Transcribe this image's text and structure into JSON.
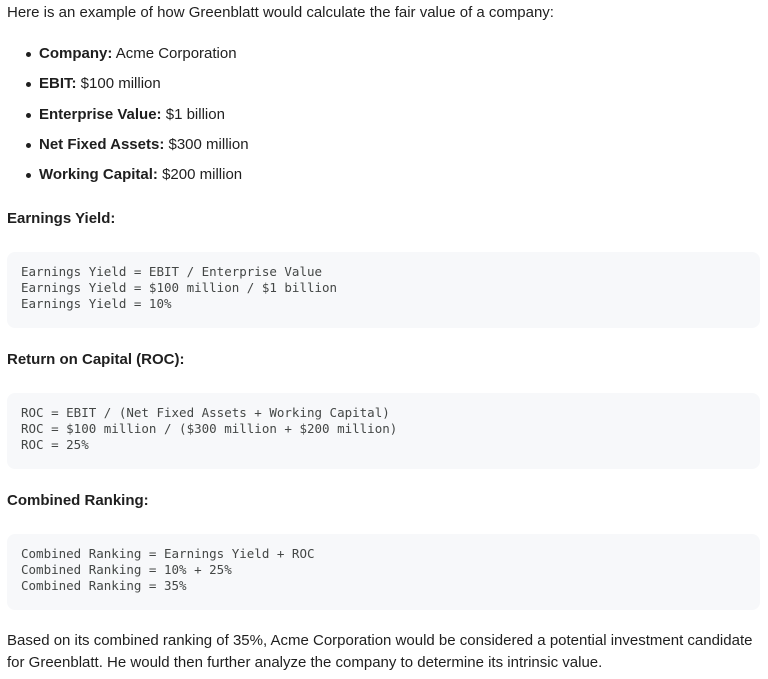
{
  "intro": "Here is an example of how Greenblatt would calculate the fair value of a company:",
  "facts": [
    {
      "key": "Company:",
      "value": "Acme Corporation"
    },
    {
      "key": "EBIT:",
      "value": "$100 million"
    },
    {
      "key": "Enterprise Value:",
      "value": "$1 billion"
    },
    {
      "key": "Net Fixed Assets:",
      "value": "$300 million"
    },
    {
      "key": "Working Capital:",
      "value": "$200 million"
    }
  ],
  "sections": [
    {
      "heading": "Earnings Yield:",
      "code": [
        "Earnings Yield = EBIT / Enterprise Value",
        "Earnings Yield = $100 million / $1 billion",
        "Earnings Yield = 10%"
      ]
    },
    {
      "heading": "Return on Capital (ROC):",
      "code": [
        "ROC = EBIT / (Net Fixed Assets + Working Capital)",
        "ROC = $100 million / ($300 million + $200 million)",
        "ROC = 25%"
      ]
    },
    {
      "heading": "Combined Ranking:",
      "code": [
        "Combined Ranking = Earnings Yield + ROC",
        "Combined Ranking = 10% + 25%",
        "Combined Ranking = 35%"
      ]
    }
  ],
  "closing": "Based on its combined ranking of 35%, Acme Corporation would be considered a potential investment candidate for Greenblatt. He would then further analyze the company to determine its intrinsic value."
}
